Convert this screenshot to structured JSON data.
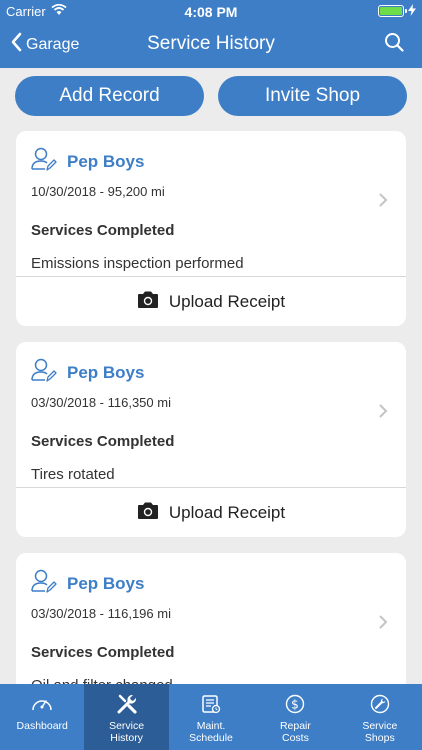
{
  "status": {
    "carrier": "Carrier",
    "time": "4:08 PM"
  },
  "nav": {
    "back_label": "Garage",
    "title": "Service History"
  },
  "actions": {
    "add_label": "Add Record",
    "invite_label": "Invite Shop"
  },
  "services_label": "Services Completed",
  "upload_label": "Upload Receipt",
  "records": [
    {
      "shop": "Pep Boys",
      "date_miles": "10/30/2018 - 95,200 mi",
      "service": "Emissions inspection performed"
    },
    {
      "shop": "Pep Boys",
      "date_miles": "03/30/2018 - 116,350 mi",
      "service": "Tires rotated"
    },
    {
      "shop": "Pep Boys",
      "date_miles": "03/30/2018 - 116,196 mi",
      "service": "Oil and filter changed"
    }
  ],
  "tabs": [
    {
      "label": "Dashboard",
      "icon": "gauge-icon"
    },
    {
      "label": "Service\nHistory",
      "icon": "tools-icon"
    },
    {
      "label": "Maint.\nSchedule",
      "icon": "schedule-icon"
    },
    {
      "label": "Repair\nCosts",
      "icon": "dollar-icon"
    },
    {
      "label": "Service\nShops",
      "icon": "wrench-icon"
    }
  ],
  "colors": {
    "primary": "#3d7ec6",
    "tab_active": "#2c5d96",
    "background": "#ececec"
  }
}
